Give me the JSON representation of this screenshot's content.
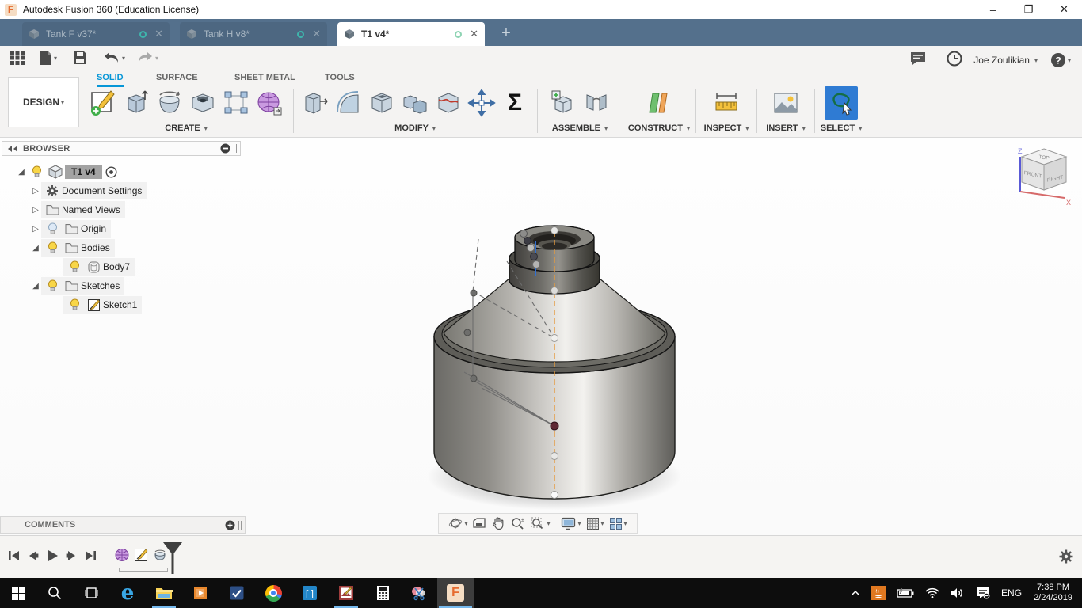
{
  "titlebar": {
    "title": "Autodesk Fusion 360 (Education License)",
    "logo": "F"
  },
  "tabs": {
    "items": [
      {
        "label": "Tank F v37*"
      },
      {
        "label": "Tank H v8*"
      },
      {
        "label": "T1 v4*"
      }
    ],
    "new_tab": "+"
  },
  "ribbon": {
    "workspace": "DESIGN",
    "tabs": [
      {
        "label": "SOLID"
      },
      {
        "label": "SURFACE"
      },
      {
        "label": "SHEET METAL"
      },
      {
        "label": "TOOLS"
      }
    ],
    "groups": {
      "create": "CREATE",
      "modify": "MODIFY",
      "assemble": "ASSEMBLE",
      "construct": "CONSTRUCT",
      "inspect": "INSPECT",
      "insert": "INSERT",
      "select": "SELECT"
    },
    "parameters_symbol": "Σ"
  },
  "account": {
    "user": "Joe Zoulikian",
    "help": "?"
  },
  "browser": {
    "title": "BROWSER",
    "root": {
      "label": "T1 v4"
    },
    "items": [
      {
        "label": "Document Settings"
      },
      {
        "label": "Named Views"
      },
      {
        "label": "Origin"
      },
      {
        "label": "Bodies"
      },
      {
        "label": "Body7"
      },
      {
        "label": "Sketches"
      },
      {
        "label": "Sketch1"
      }
    ]
  },
  "viewcube": {
    "top": "TOP",
    "front": "FRONT",
    "right": "RIGHT",
    "axis_z": "Z",
    "axis_x": "X"
  },
  "comments": {
    "title": "COMMENTS"
  },
  "taskbar": {
    "language": "ENG",
    "time": "7:38 PM",
    "date": "2/24/2019"
  },
  "colors": {
    "accent": "#0696d7",
    "tabbar": "#54708c",
    "select_active": "#2f7bd3",
    "axis_orange": "#e59a3c"
  }
}
